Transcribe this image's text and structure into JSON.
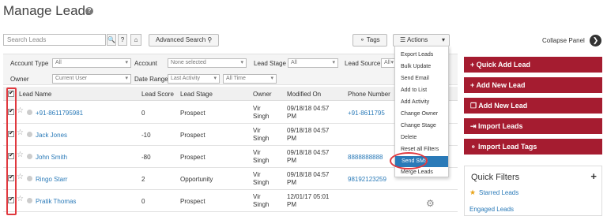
{
  "page": {
    "title": "Manage Leads",
    "help_icon": "?"
  },
  "toolbar": {
    "search_placeholder": "Search Leads",
    "help_btn": "?",
    "advanced_search": "Advanced Search",
    "tags": "Tags",
    "actions": "Actions"
  },
  "filters": {
    "account_type_label": "Account Type",
    "account_type_value": "All",
    "account_label": "Account",
    "account_value": "None selected",
    "lead_stage_label": "Lead Stage",
    "lead_stage_value": "All",
    "lead_source_label": "Lead Source",
    "lead_source_value": "All",
    "owner_label": "Owner",
    "owner_value": "Current User",
    "date_range_label": "Date Range",
    "date_range_value": "Last Activity",
    "date_range_period": "All Time"
  },
  "table": {
    "columns": [
      "Lead Name",
      "Lead Score",
      "Lead Stage",
      "Owner",
      "Modified On",
      "Phone Number"
    ],
    "rows": [
      {
        "name": "+91-8611795981",
        "score": "0",
        "stage": "Prospect",
        "owner1": "Vir",
        "owner2": "Singh",
        "mod1": "09/18/18 04:57",
        "mod2": "PM",
        "phone": "+91-8611795"
      },
      {
        "name": "Jack Jones",
        "score": "-10",
        "stage": "Prospect",
        "owner1": "Vir",
        "owner2": "Singh",
        "mod1": "09/18/18 04:57",
        "mod2": "PM",
        "phone": ""
      },
      {
        "name": "John Smith",
        "score": "-80",
        "stage": "Prospect",
        "owner1": "Vir",
        "owner2": "Singh",
        "mod1": "09/18/18 04:57",
        "mod2": "PM",
        "phone": "8888888888"
      },
      {
        "name": "Ringo Starr",
        "score": "2",
        "stage": "Opportunity",
        "owner1": "Vir",
        "owner2": "Singh",
        "mod1": "09/18/18 04:57",
        "mod2": "PM",
        "phone": "98192123259"
      },
      {
        "name": "Pratik Thomas",
        "score": "0",
        "stage": "Prospect",
        "owner1": "Vir",
        "owner2": "Singh",
        "mod1": "12/01/17 05:01",
        "mod2": "PM",
        "phone": ""
      }
    ]
  },
  "actions_menu": [
    "Export Leads",
    "Bulk Update",
    "Send Email",
    "Add to List",
    "Add Activity",
    "Change Owner",
    "Change Stage",
    "Delete",
    "Reset all Filters",
    "Send SMS",
    "Merge Leads"
  ],
  "sidebar": {
    "collapse": "Collapse Panel",
    "buttons": [
      "Quick Add Lead",
      "Add New Lead",
      "Add New Lead",
      "Import Leads",
      "Import Lead Tags"
    ],
    "quick_filters": "Quick Filters",
    "plus": "+",
    "starred": "Starred Leads",
    "engaged": "Engaged Leads"
  },
  "colors": {
    "accent": "#a51c30",
    "link": "#2a7ab8",
    "highlight": "#e0393f"
  }
}
